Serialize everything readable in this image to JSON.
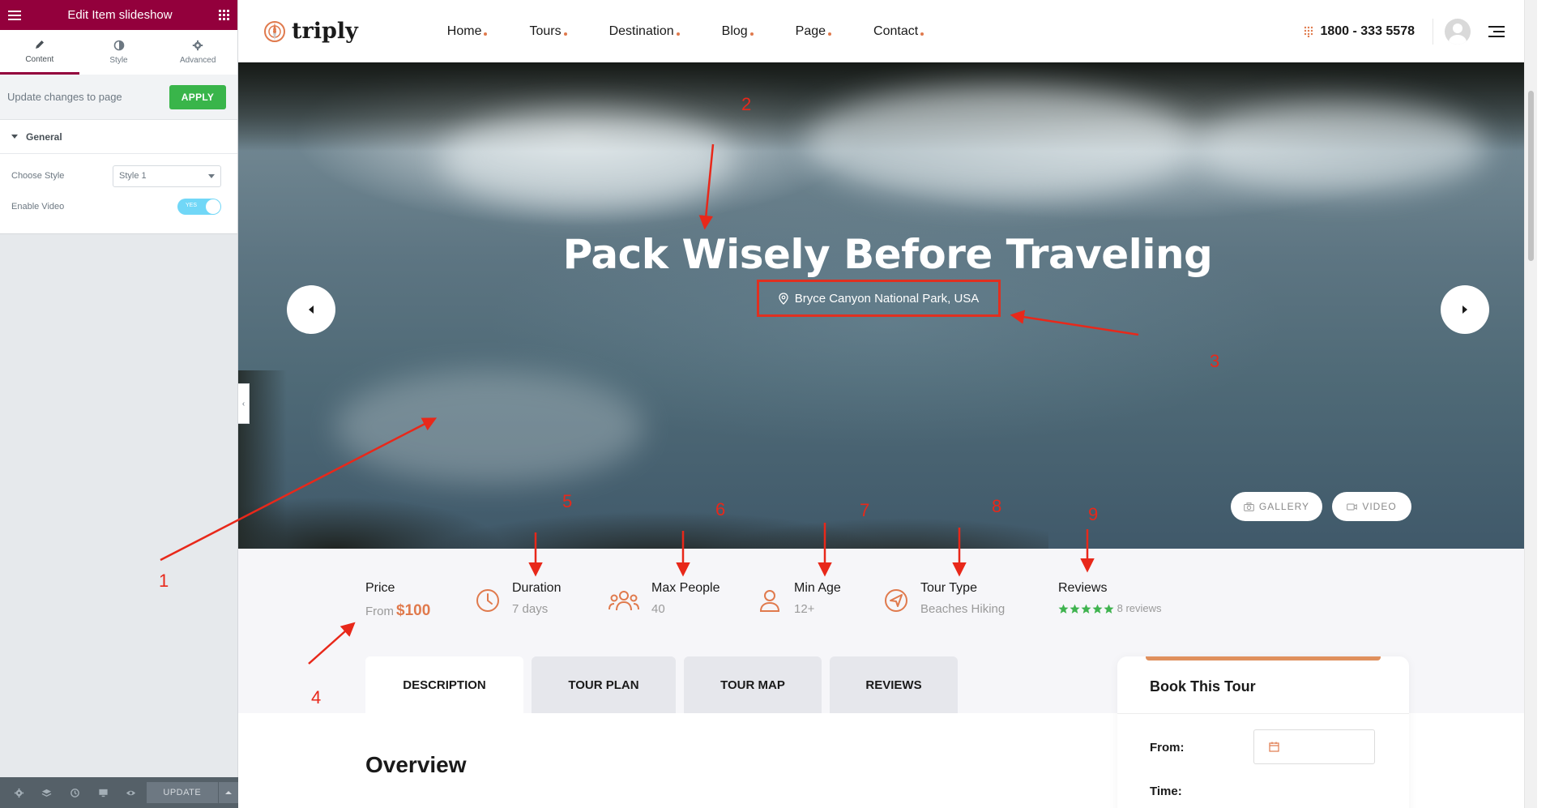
{
  "editor": {
    "title": "Edit Item slideshow",
    "tabs": [
      {
        "label": "Content",
        "icon": "pencil-icon"
      },
      {
        "label": "Style",
        "icon": "contrast-icon"
      },
      {
        "label": "Advanced",
        "icon": "gear-icon"
      }
    ],
    "apply_text": "Update changes to page",
    "apply_label": "APPLY",
    "section": "General",
    "choose_style_label": "Choose Style",
    "choose_style_value": "Style 1",
    "enable_video_label": "Enable Video",
    "enable_video_value": "YES",
    "update_label": "UPDATE"
  },
  "site": {
    "logo": "triply",
    "menu": [
      "Home",
      "Tours",
      "Destination",
      "Blog",
      "Page",
      "Contact"
    ],
    "phone": "1800 - 333 5578",
    "hero": {
      "title": "Pack Wisely Before Traveling",
      "location": "Bryce Canyon National Park, USA",
      "gallery_label": "GALLERY",
      "video_label": "VIDEO"
    },
    "info": {
      "price_label": "Price",
      "price_prefix": "From",
      "price_value": "$100",
      "duration_label": "Duration",
      "duration_value": "7 days",
      "people_label": "Max People",
      "people_value": "40",
      "age_label": "Min Age",
      "age_value": "12+",
      "type_label": "Tour Type",
      "type_value": "Beaches Hiking",
      "reviews_label": "Reviews",
      "reviews_value": "8 reviews",
      "rating": 5
    },
    "tabs": [
      "DESCRIPTION",
      "TOUR PLAN",
      "TOUR MAP",
      "REVIEWS"
    ],
    "overview": "Overview",
    "booking": {
      "title": "Book This Tour",
      "from_label": "From:",
      "time_label": "Time:"
    }
  },
  "annotations": [
    "1",
    "2",
    "3",
    "4",
    "5",
    "6",
    "7",
    "8",
    "9"
  ],
  "colors": {
    "editor_header": "#93003c",
    "apply": "#39b54a",
    "accent": "#e07a4d",
    "annotation": "#e8281a"
  }
}
